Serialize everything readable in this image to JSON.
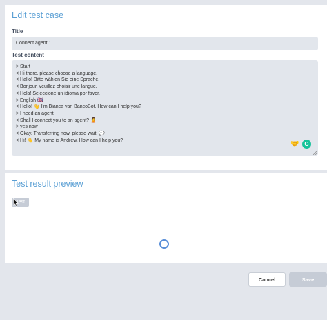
{
  "edit_panel": {
    "title": "Edit test case",
    "title_label": "Title",
    "title_value": "Connect agent 1",
    "content_label": "Test content",
    "content_lines": [
      "> Start",
      "< Hi there, please choose a language.",
      "< Hallo! Bitte wählen Sie eine Sprache.",
      "< Bonjour, veuillez choisir une langue.",
      "< Hola! Seleccione un idioma por favor.",
      "> English 🇬🇧",
      "< Hello! 👋 I'm Bianca van BancoBot. How can I help you?",
      "> I need an agent",
      "< Shall I connect you to an agent? 🙎",
      "> yes now",
      "< Okay. Transferring now, please wait. 💬",
      "< Hi! 👋 My name is Andrew. How can I help you?"
    ]
  },
  "preview_panel": {
    "title": "Test result preview",
    "test_button": "Test"
  },
  "footer": {
    "cancel": "Cancel",
    "save": "Save"
  },
  "icons": {
    "editor_tool_1": "heart-hands-icon",
    "editor_tool_2": "grammarly-icon",
    "spinner": "loading-spinner-icon"
  },
  "colors": {
    "accent": "#5a9fd4",
    "input_bg": "#e2e6ec",
    "page_bg": "#e3e6ec",
    "grammarly": "#15c39a"
  }
}
